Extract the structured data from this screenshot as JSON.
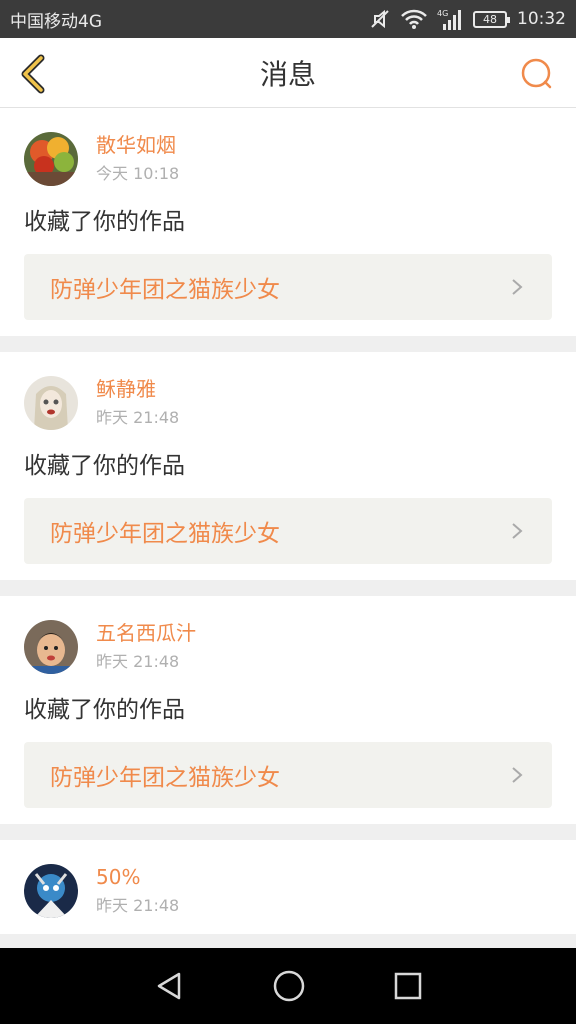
{
  "status_bar": {
    "carrier": "中国移动4G",
    "battery": "48",
    "time": "10:32",
    "network": "4G"
  },
  "nav": {
    "title": "消息"
  },
  "messages": [
    {
      "user": "散华如烟",
      "time": "今天 10:18",
      "action": "收藏了你的作品",
      "work": "防弹少年团之猫族少女"
    },
    {
      "user": "稣静雅",
      "time": "昨天 21:48",
      "action": "收藏了你的作品",
      "work": "防弹少年团之猫族少女"
    },
    {
      "user": "五名西瓜汁",
      "time": "昨天 21:48",
      "action": "收藏了你的作品",
      "work": "防弹少年团之猫族少女"
    },
    {
      "user": "50%",
      "time": "昨天 21:48",
      "action": "",
      "work": ""
    }
  ],
  "colors": {
    "accent": "#f08a4b",
    "text": "#333333",
    "muted": "#b0b0b0",
    "work_bg": "#f2f2ee"
  }
}
